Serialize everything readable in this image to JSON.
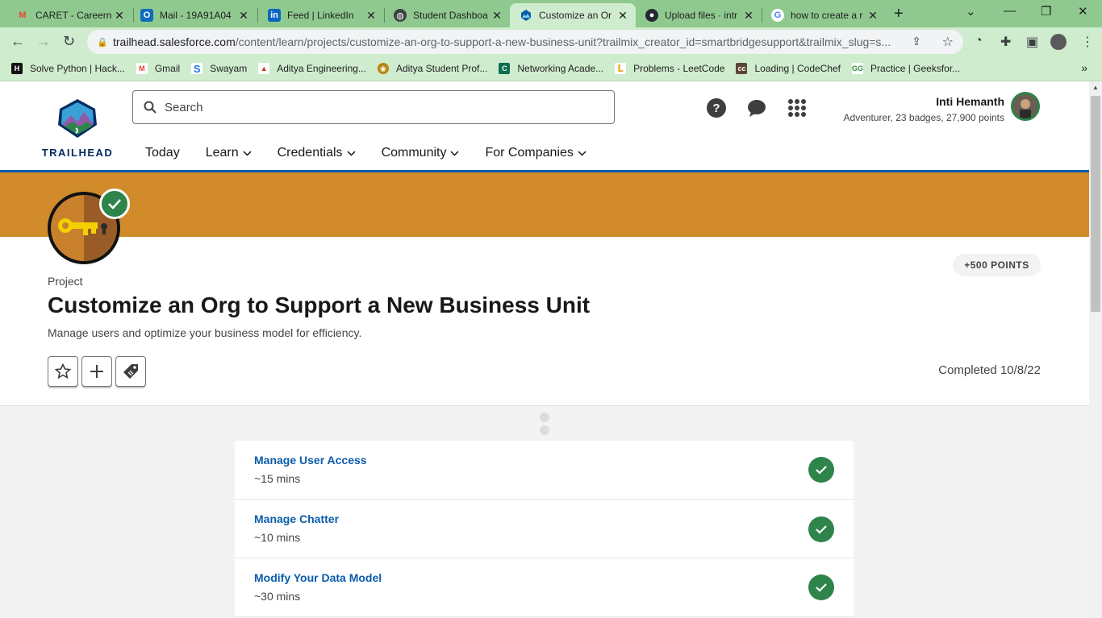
{
  "browser": {
    "tabs": [
      {
        "title": "CARET - Careerne",
        "icon": "gmail-icon"
      },
      {
        "title": "Mail - 19A91A04",
        "icon": "outlook-icon"
      },
      {
        "title": "Feed | LinkedIn",
        "icon": "linkedin-icon"
      },
      {
        "title": "Student Dashboa",
        "icon": "globe-icon"
      },
      {
        "title": "Customize an Or",
        "icon": "trailhead-icon",
        "active": true
      },
      {
        "title": "Upload files · intr",
        "icon": "github-icon"
      },
      {
        "title": "how to create a r",
        "icon": "google-icon"
      }
    ],
    "url_host": "trailhead.salesforce.com",
    "url_path": "/content/learn/projects/customize-an-org-to-support-a-new-business-unit?trailmix_creator_id=smartbridgesupport&trailmix_slug=s...",
    "bookmarks": [
      {
        "label": "Solve Python | Hack...",
        "color": "#1ba94c"
      },
      {
        "label": "Gmail",
        "color": "#ea4335"
      },
      {
        "label": "Swayam",
        "color": "#1a73e8"
      },
      {
        "label": "Aditya Engineering...",
        "color": "#c0392b"
      },
      {
        "label": "Aditya Student Prof...",
        "color": "#b8860b"
      },
      {
        "label": "Networking Acade...",
        "color": "#0b6e4f"
      },
      {
        "label": "Problems - LeetCode",
        "color": "#f89f1b"
      },
      {
        "label": "Loading | CodeChef",
        "color": "#5b4638"
      },
      {
        "label": "Practice | Geeksfor...",
        "color": "#2f8d46"
      }
    ]
  },
  "header": {
    "logo_text": "TRAILHEAD",
    "search_placeholder": "Search",
    "user_name": "Inti Hemanth",
    "user_meta": "Adventurer, 23 badges, 27,900 points",
    "nav": [
      "Today",
      "Learn",
      "Credentials",
      "Community",
      "For Companies"
    ]
  },
  "project": {
    "points": "+500 POINTS",
    "label": "Project",
    "title": "Customize an Org to Support a New Business Unit",
    "description": "Manage users and optimize your business model for efficiency.",
    "completed": "Completed 10/8/22",
    "steps": [
      {
        "name": "Manage User Access",
        "time": "~15 mins"
      },
      {
        "name": "Manage Chatter",
        "time": "~10 mins"
      },
      {
        "name": "Modify Your Data Model",
        "time": "~30 mins"
      }
    ]
  },
  "colors": {
    "banner": "#d18b2a",
    "brand_blue": "#0b5cab",
    "success_green": "#2e844a",
    "chrome_frame": "#8fc98f"
  }
}
